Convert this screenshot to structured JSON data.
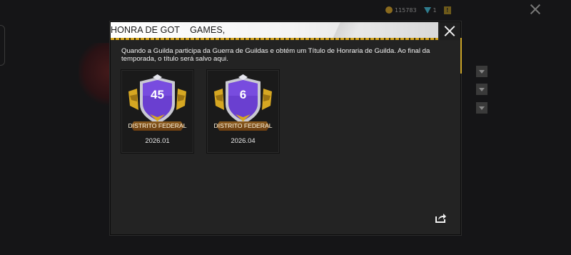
{
  "modal": {
    "title": "HONRA DE GOT    GAMES,",
    "description": "Quando a Guilda participa da Guerra de Guildas e obtém um Título de Honraria de Guilda. Ao final da temporada, o título será salvo aqui."
  },
  "badges": [
    {
      "rank": "45",
      "region": "DISTRITO FEDERAL",
      "season": "2026.01"
    },
    {
      "rank": "6",
      "region": "DISTRITO FEDERAL",
      "season": "2026.04"
    }
  ],
  "background": {
    "currency_coins": "115783",
    "currency_gems": "1"
  },
  "icons": {
    "close": "close-icon",
    "share": "share-icon",
    "coin": "coin-icon",
    "gem": "gem-icon"
  },
  "colors": {
    "accent_gold": "#d6a722",
    "badge_purple": "#6a3fd0",
    "ribbon_brown": "#7a4a16"
  }
}
